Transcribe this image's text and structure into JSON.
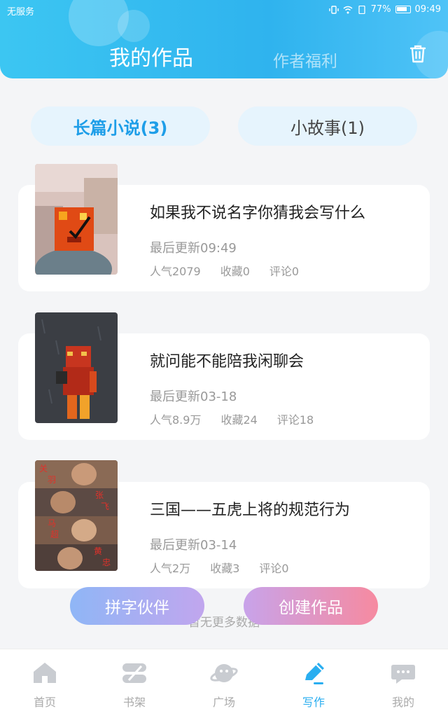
{
  "status_bar": {
    "carrier": "无服务",
    "battery": "77%",
    "time": "09:49"
  },
  "header": {
    "tab_active": "我的作品",
    "tab_inactive": "作者福利"
  },
  "categories": [
    {
      "label": "长篇小说(3)"
    },
    {
      "label": "小故事(1)"
    }
  ],
  "books": [
    {
      "title": "如果我不说名字你猜我会写什么",
      "updated": "最后更新09:49",
      "popularity": "人气2079",
      "favorites": "收藏0",
      "comments": "评论0"
    },
    {
      "title": "就问能不能陪我闲聊会",
      "updated": "最后更新03-18",
      "popularity": "人气8.9万",
      "favorites": "收藏24",
      "comments": "评论18"
    },
    {
      "title": "三国——五虎上将的规范行为",
      "updated": "最后更新03-14",
      "popularity": "人气2万",
      "favorites": "收藏3",
      "comments": "评论0"
    }
  ],
  "cover3_labels": [
    "关",
    "羽",
    "张",
    "飞",
    "马",
    "超",
    "黄",
    "忠"
  ],
  "buttons": {
    "partner": "拼字伙伴",
    "create": "创建作品"
  },
  "no_more": "暂无更多数据",
  "nav": [
    {
      "label": "首页",
      "icon": "home-icon"
    },
    {
      "label": "书架",
      "icon": "bookshelf-icon"
    },
    {
      "label": "广场",
      "icon": "planet-icon"
    },
    {
      "label": "写作",
      "icon": "pen-icon"
    },
    {
      "label": "我的",
      "icon": "chat-bubble-icon"
    }
  ],
  "colors": {
    "accent": "#2aaef0",
    "header": "#3cc6f2",
    "muted": "#aaaaaa"
  }
}
